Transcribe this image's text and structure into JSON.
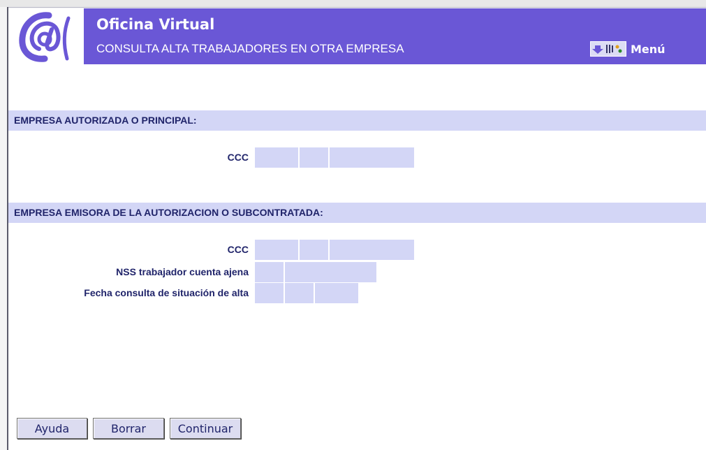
{
  "header": {
    "title": "Oficina Virtual",
    "subtitle": "CONSULTA ALTA TRABAJADORES EN OTRA EMPRESA",
    "menu_label": "Menú",
    "logo_icon": "at-sign-logo-icon",
    "menu_icons": [
      "arrow-down-icon",
      "tools-icon"
    ]
  },
  "sections": {
    "principal": {
      "title": "EMPRESA AUTORIZADA O PRINCIPAL:",
      "ccc_label": "CCC"
    },
    "emisora": {
      "title": "EMPRESA EMISORA DE LA AUTORIZACION O SUBCONTRATADA:",
      "ccc_label": "CCC",
      "nss_label": "NSS trabajador cuenta ajena",
      "fecha_label": "Fecha consulta de situación de alta"
    }
  },
  "fields": {
    "principal_ccc": [
      "",
      "",
      ""
    ],
    "emisora_ccc": [
      "",
      "",
      ""
    ],
    "nss": [
      "",
      ""
    ],
    "fecha": [
      "",
      "",
      ""
    ]
  },
  "buttons": {
    "ayuda": "Ayuda",
    "borrar": "Borrar",
    "continuar": "Continuar"
  },
  "colors": {
    "header_bg": "#6a57d6",
    "section_bg": "#d3d6f6",
    "label_text": "#20246a"
  }
}
